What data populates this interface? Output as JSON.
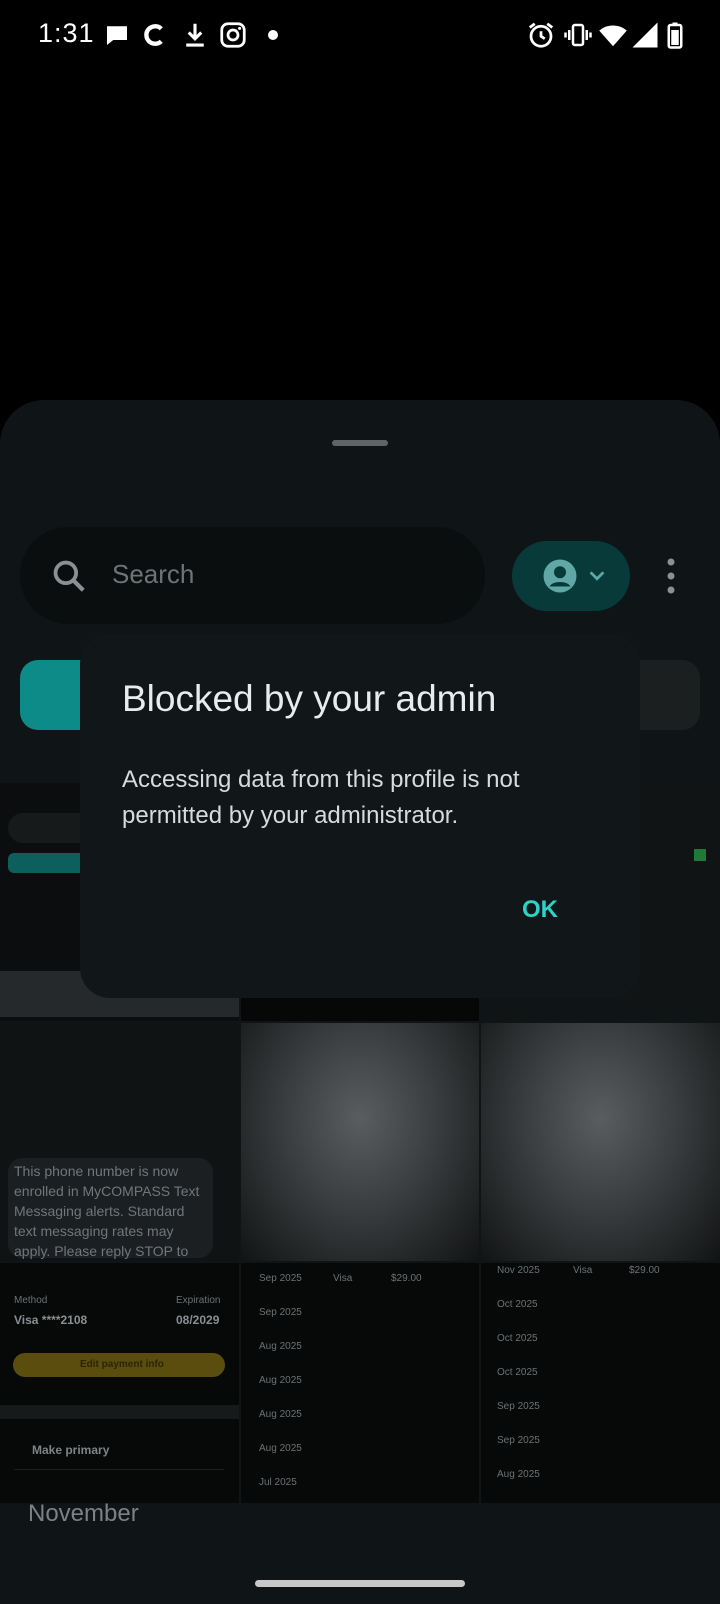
{
  "status_bar": {
    "time": "1:31",
    "left_icons": [
      "chat-bubble-icon",
      "c-app-icon",
      "download-icon",
      "instagram-icon",
      "dot-icon"
    ],
    "right_icons": [
      "alarm-icon",
      "vibrate-icon",
      "wifi-icon",
      "signal-icon",
      "battery-icon"
    ]
  },
  "search": {
    "placeholder": "Search"
  },
  "background_preview": {
    "sms_text": "This phone number is now enrolled in MyCOMPASS Text Messaging alerts. Standard text messaging rates may apply. Please reply STOP to",
    "payment_method_label": "Method",
    "payment_method_value": "Visa ****2108",
    "expiration_label": "Expiration",
    "expiration_value": "08/2029",
    "edit_button": "Edit payment info",
    "make_primary": "Make primary",
    "history_col2": [
      "Sep 2025",
      "Sep 2025",
      "Aug 2025",
      "Aug 2025",
      "Aug 2025",
      "Aug 2025",
      "Jul 2025"
    ],
    "history_col3": [
      "Nov 2025",
      "Oct 2025",
      "Oct 2025",
      "Oct 2025",
      "Sep 2025",
      "Sep 2025",
      "Aug 2025"
    ],
    "card_type": "Visa",
    "amount": "$29.00"
  },
  "month_label": "November",
  "dialog": {
    "title": "Blocked by your admin",
    "message": "Accessing data from this profile is not permitted by your administrator.",
    "ok_label": "OK"
  },
  "colors": {
    "accent": "#2fd1c8",
    "sheet_bg": "#0f1516",
    "dialog_bg": "#111718",
    "profile_chip": "#083a3a"
  }
}
